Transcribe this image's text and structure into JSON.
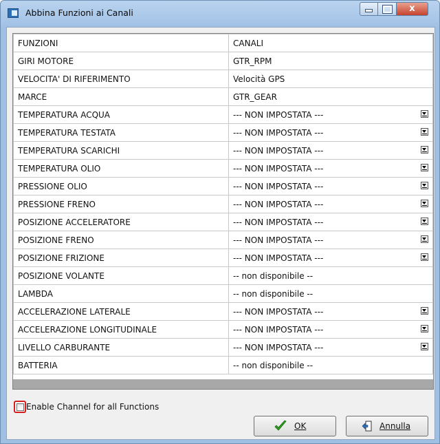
{
  "window": {
    "title": "Abbina Funzioni ai Canali",
    "close_glyph": "x"
  },
  "table": {
    "headers": [
      "FUNZIONI",
      "CANALI"
    ],
    "rows": [
      {
        "func": "GIRI MOTORE",
        "channel": "GTR_RPM",
        "dropdown": false
      },
      {
        "func": "VELOCITA' DI RIFERIMENTO",
        "channel": "Velocità GPS",
        "dropdown": false
      },
      {
        "func": "MARCE",
        "channel": "GTR_GEAR",
        "dropdown": false
      },
      {
        "func": "TEMPERATURA ACQUA",
        "channel": "--- NON IMPOSTATA ---",
        "dropdown": true
      },
      {
        "func": "TEMPERATURA TESTATA",
        "channel": "--- NON IMPOSTATA ---",
        "dropdown": true
      },
      {
        "func": "TEMPERATURA SCARICHI",
        "channel": "--- NON IMPOSTATA ---",
        "dropdown": true
      },
      {
        "func": "TEMPERATURA OLIO",
        "channel": "--- NON IMPOSTATA ---",
        "dropdown": true
      },
      {
        "func": "PRESSIONE OLIO",
        "channel": "--- NON IMPOSTATA ---",
        "dropdown": true
      },
      {
        "func": "PRESSIONE FRENO",
        "channel": "--- NON IMPOSTATA ---",
        "dropdown": true
      },
      {
        "func": "POSIZIONE ACCELERATORE",
        "channel": "--- NON IMPOSTATA ---",
        "dropdown": true
      },
      {
        "func": "POSIZIONE FRENO",
        "channel": "--- NON IMPOSTATA ---",
        "dropdown": true
      },
      {
        "func": "POSIZIONE FRIZIONE",
        "channel": "--- NON IMPOSTATA ---",
        "dropdown": true
      },
      {
        "func": "POSIZIONE VOLANTE",
        "channel": "-- non disponibile --",
        "dropdown": false
      },
      {
        "func": "LAMBDA",
        "channel": "-- non disponibile --",
        "dropdown": false
      },
      {
        "func": "ACCELERAZIONE LATERALE",
        "channel": "--- NON IMPOSTATA ---",
        "dropdown": true
      },
      {
        "func": "ACCELERAZIONE LONGITUDINALE",
        "channel": "--- NON IMPOSTATA ---",
        "dropdown": true
      },
      {
        "func": "LIVELLO CARBURANTE",
        "channel": "--- NON IMPOSTATA ---",
        "dropdown": true
      },
      {
        "func": "BATTERIA",
        "channel": "-- non disponibile --",
        "dropdown": false
      }
    ]
  },
  "options": {
    "enable_all_label": "Enable Channel for all Functions",
    "enable_all_checked": false
  },
  "buttons": {
    "ok_label": "OK",
    "cancel_label": "Annulla"
  },
  "colors": {
    "accent_outline": "#d61e1e",
    "ok_check": "#2e9b1e"
  }
}
